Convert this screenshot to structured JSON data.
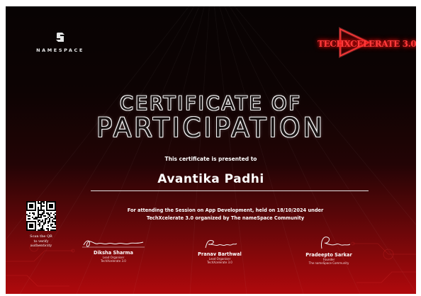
{
  "left_logo": {
    "text": "NAMESPACE"
  },
  "right_logo": {
    "text": "TECHXCELERATE 3.0"
  },
  "title": {
    "line1": "CERTIFICATE OF",
    "line2": "PARTICIPATION"
  },
  "presented_to": "This certificate is presented to",
  "recipient": "Avantika Padhi",
  "event_text_line1": "For attending the Session on App Development, held on 18/10/2024 under",
  "event_text_line2": "TechXcelerate 3.0 organized by The nameSpace Community",
  "qr": {
    "caption_line1": "Scan the QR",
    "caption_line2": "to verify",
    "caption_line3": "authenticity"
  },
  "signatories": [
    {
      "signature": "Diksha Sharma",
      "name": "Diksha Sharma",
      "role": "Lead Organiser",
      "org": "TechXcelerate 3.0"
    },
    {
      "signature": "Pranav",
      "name": "Pranav Barthwal",
      "role": "Lead Organiser",
      "org": "TechXcelerate 3.0"
    },
    {
      "signature": "Pradeepto",
      "name": "Pradeepto Sarkar",
      "role": "Founder",
      "org": "The nameSpace Community"
    }
  ],
  "colors": {
    "background_top": "#080303",
    "background_bottom": "#b0090c",
    "accent_red": "#ff2a2a",
    "text": "#ffffff"
  }
}
